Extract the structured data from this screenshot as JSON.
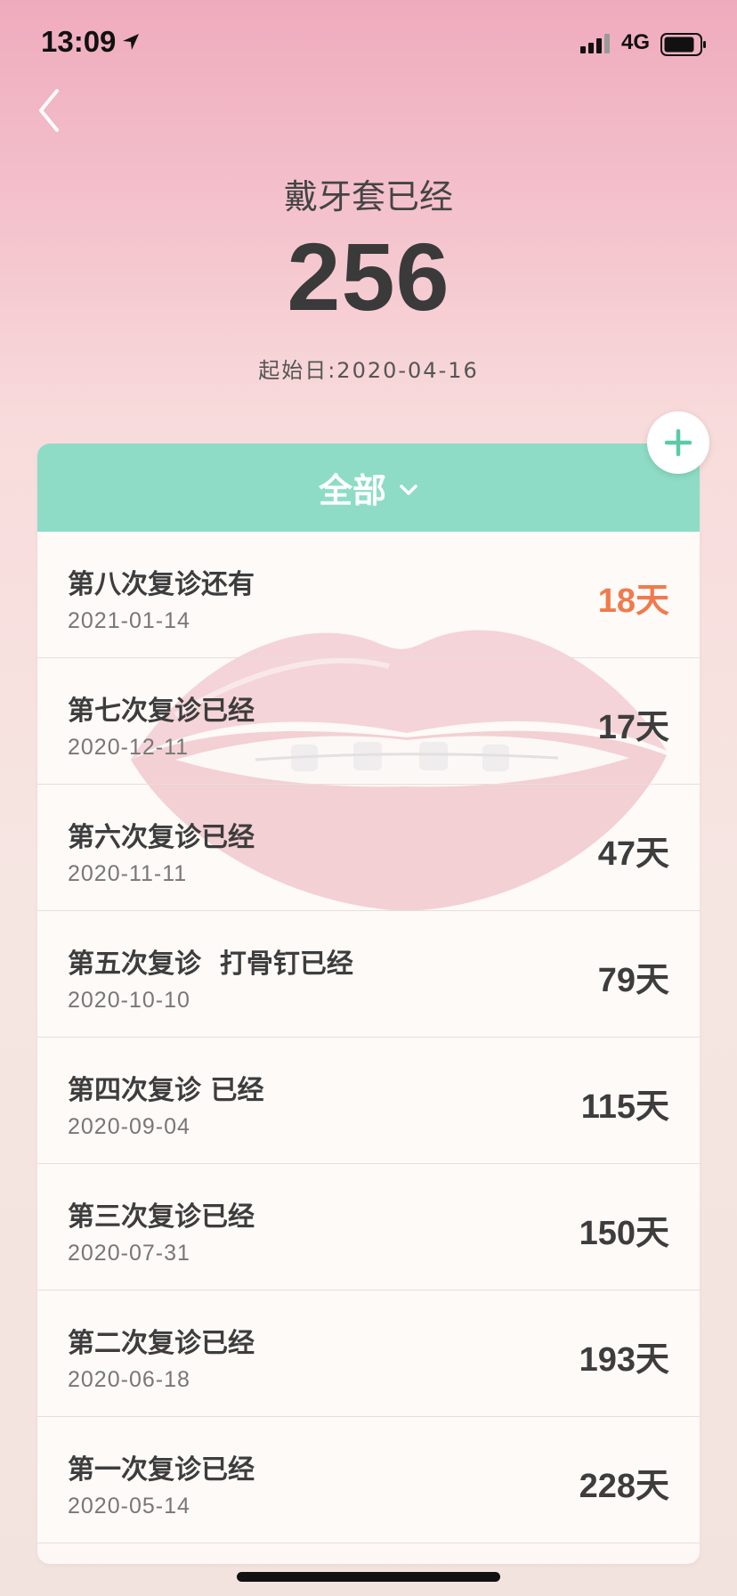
{
  "status_bar": {
    "time": "13:09",
    "network": "4G"
  },
  "header": {
    "title": "戴牙套已经",
    "day_count": "256",
    "start_date_label": "起始日:2020-04-16"
  },
  "filter": {
    "label": "全部"
  },
  "rows": [
    {
      "title": "第八次复诊还有",
      "date": "2021-01-14",
      "days": "18天",
      "highlight": true
    },
    {
      "title": "第七次复诊已经",
      "date": "2020-12-11",
      "days": "17天"
    },
    {
      "title": "第六次复诊已经",
      "date": "2020-11-11",
      "days": "47天"
    },
    {
      "title": "第五次复诊  打骨钉已经",
      "date": "2020-10-10",
      "days": "79天"
    },
    {
      "title": "第四次复诊 已经",
      "date": "2020-09-04",
      "days": "115天"
    },
    {
      "title": "第三次复诊已经",
      "date": "2020-07-31",
      "days": "150天"
    },
    {
      "title": "第二次复诊已经",
      "date": "2020-06-18",
      "days": "193天"
    },
    {
      "title": "第一次复诊已经",
      "date": "2020-05-14",
      "days": "228天"
    }
  ],
  "colors": {
    "accent": "#8edcc5",
    "highlight": "#ef7b4d",
    "add_icon": "#5ccaa8"
  },
  "icons": {
    "back": "chevron-left-icon",
    "filter": "chevron-down-icon",
    "add": "plus-icon",
    "location": "location-arrow-icon",
    "signal": "signal-icon",
    "battery": "battery-icon"
  }
}
